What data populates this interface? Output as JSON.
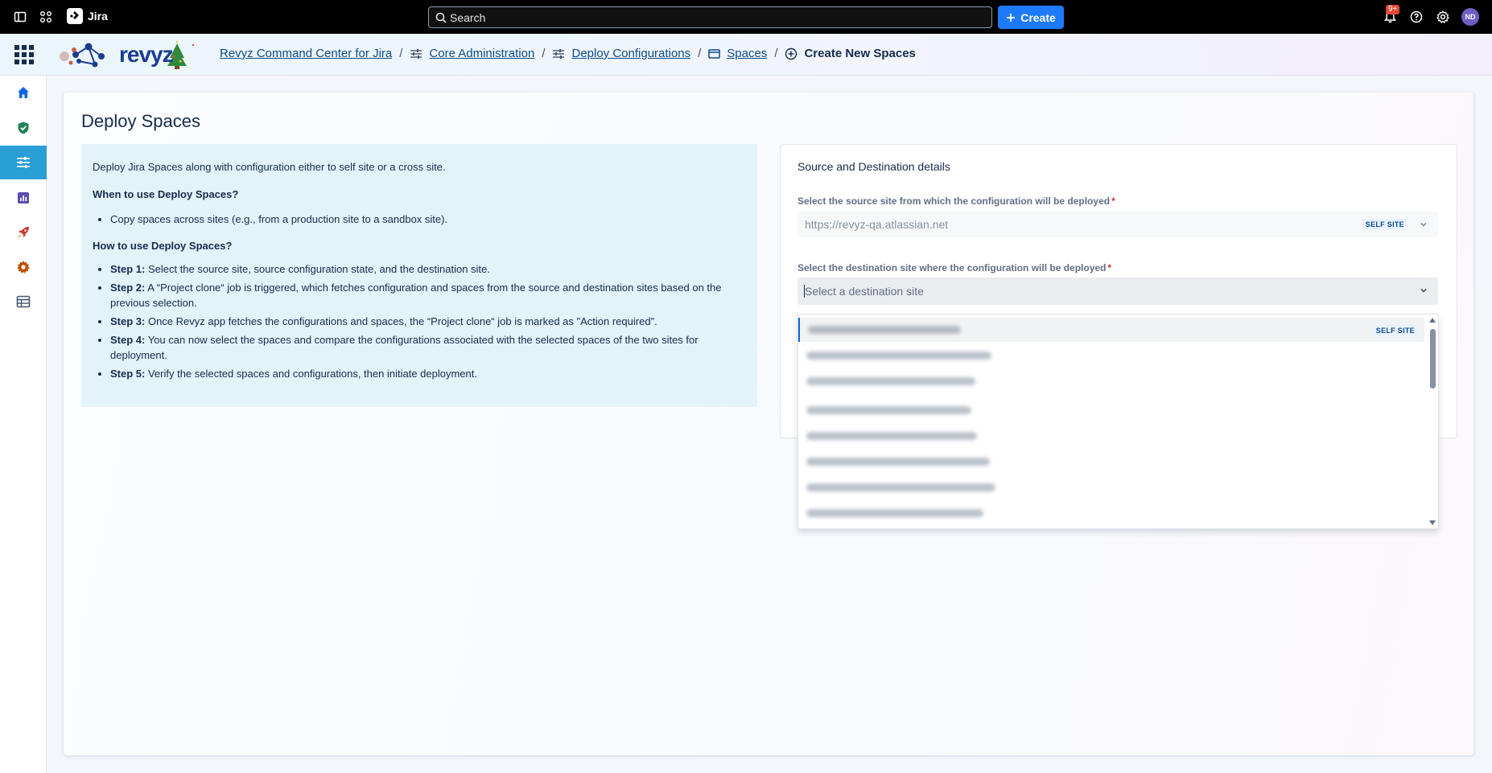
{
  "topbar": {
    "app_name": "Jira",
    "search_placeholder": "Search",
    "create_label": "Create",
    "notifications_badge": "9+",
    "avatar_initials": "ND"
  },
  "header": {
    "logo_text": "revyz",
    "breadcrumbs": [
      {
        "label": "Revyz Command Center for Jira"
      },
      {
        "label": "Core Administration"
      },
      {
        "label": "Deploy Configurations"
      },
      {
        "label": "Spaces"
      },
      {
        "label": "Create New Spaces"
      }
    ]
  },
  "sidebar": {
    "items": [
      {
        "icon": "home-icon"
      },
      {
        "icon": "shield-check-icon"
      },
      {
        "icon": "sliders-icon",
        "active": true
      },
      {
        "icon": "bar-chart-icon"
      },
      {
        "icon": "rocket-icon"
      },
      {
        "icon": "gear-icon"
      },
      {
        "icon": "table-icon"
      }
    ]
  },
  "page": {
    "title": "Deploy Spaces"
  },
  "info": {
    "intro": "Deploy Jira Spaces along with configuration either to self site or a cross site.",
    "when_heading": "When to use Deploy Spaces?",
    "when_items": [
      "Copy spaces across sites (e.g., from a production site to a sandbox site)."
    ],
    "how_heading": "How to use Deploy Spaces?",
    "steps": [
      {
        "label": "Step 1:",
        "text": " Select the source site, source configuration state, and the destination site."
      },
      {
        "label": "Step 2:",
        "text": " A “Project clone“ job is triggered, which fetches configuration and spaces from the source and destination sites based on the previous selection."
      },
      {
        "label": "Step 3:",
        "text": " Once Revyz app fetches the configurations and spaces, the “Project clone“ job is marked as \"Action required\"."
      },
      {
        "label": "Step 4:",
        "text": " You can now select the spaces and compare the configurations associated with the selected spaces of the two sites for deployment."
      },
      {
        "label": "Step 5:",
        "text": " Verify the selected spaces and configurations, then initiate deployment."
      }
    ]
  },
  "form": {
    "panel_title": "Source and Destination details",
    "source_label": "Select the source site from which the configuration will be deployed",
    "source_value": "https://revyz-qa.atlassian.net",
    "source_tag": "SELF SITE",
    "required_mark": "*",
    "destination_label": "Select the destination site where the configuration will be deployed",
    "destination_placeholder": "Select a destination site",
    "options_self_tag": "SELF SITE"
  },
  "colors": {
    "topbar_bg": "#000000",
    "accent_blue": "#1d7afc",
    "sidebar_active": "#2a9fd6",
    "info_bg": "#e2f3fa",
    "link": "#0c4a8a"
  }
}
